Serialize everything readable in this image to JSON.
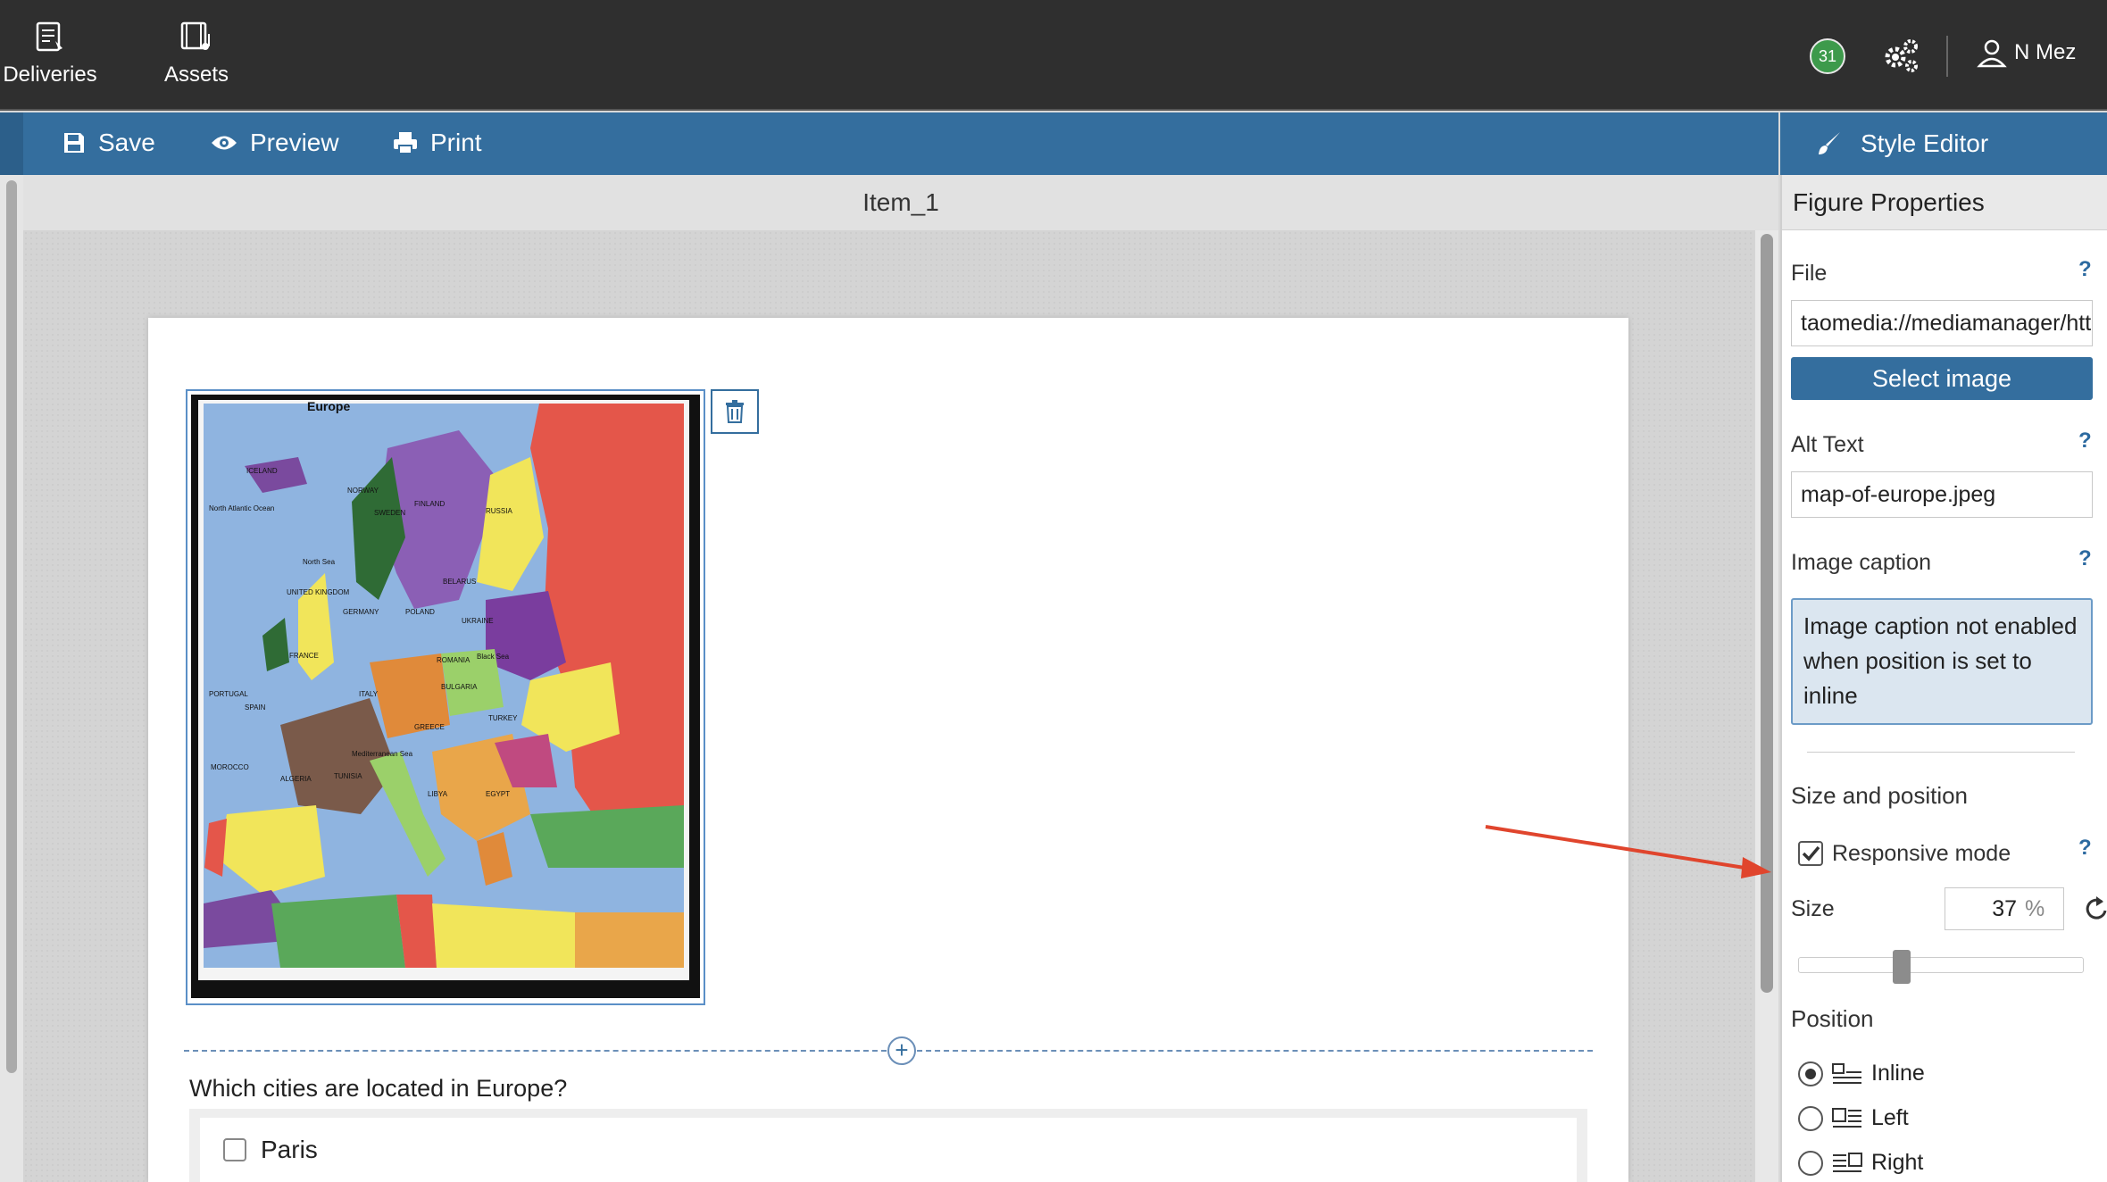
{
  "topnav": {
    "items": [
      {
        "label": "Deliveries",
        "icon": "deliveries-icon"
      },
      {
        "label": "Assets",
        "icon": "assets-icon"
      }
    ],
    "notification_count": "31",
    "user_name": "N Mez"
  },
  "toolbar": {
    "save_label": "Save",
    "preview_label": "Preview",
    "print_label": "Print",
    "style_editor_label": "Style Editor"
  },
  "item": {
    "title": "Item_1",
    "figure": {
      "map_title": "Europe",
      "map_labels": [
        "NORWAY",
        "SWEDEN",
        "FINLAND",
        "RUSSIA",
        "ICELAND",
        "UNITED KINGDOM",
        "GERMANY",
        "POLAND",
        "UKRAINE",
        "BELARUS",
        "FRANCE",
        "SPAIN",
        "PORTUGAL",
        "ITALY",
        "ROMANIA",
        "BULGARIA",
        "TURKEY",
        "GREECE",
        "ALGERIA",
        "MOROCCO",
        "TUNISIA",
        "LIBYA",
        "EGYPT",
        "North Atlantic Ocean",
        "Mediterranean Sea",
        "Black Sea",
        "North Sea"
      ]
    },
    "question": "Which cities are located in Europe?",
    "choices": [
      "Paris"
    ]
  },
  "panel": {
    "title": "Figure Properties",
    "file_label": "File",
    "file_value": "taomedia://mediamanager/https_2_taoinstance_0_rdf_3_i",
    "select_image_label": "Select image",
    "alt_text_label": "Alt Text",
    "alt_text_value": "map-of-europe.jpeg",
    "caption_label": "Image caption",
    "caption_notice": "Image caption not enabled when position is set to inline",
    "size_position_label": "Size and position",
    "responsive_label": "Responsive mode",
    "responsive_checked": true,
    "size_label": "Size",
    "size_value": "37",
    "size_unit": "%",
    "position_label": "Position",
    "position_options": [
      "Inline",
      "Left",
      "Right"
    ],
    "position_selected": "Inline",
    "help_mark": "?"
  },
  "colors": {
    "topbar": "#2f2f2f",
    "toolbar": "#346e9e",
    "badge": "#3d9a4b",
    "annotation_arrow": "#e0452d"
  }
}
